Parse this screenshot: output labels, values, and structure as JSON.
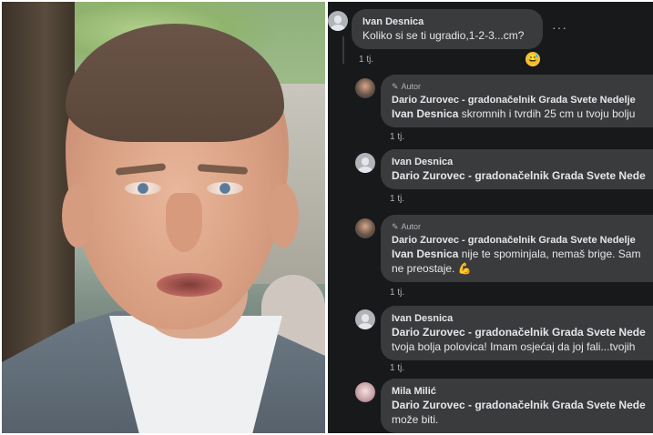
{
  "comments": [
    {
      "author": "Ivan Desnica",
      "text": "Koliko si se ti ugradio,1-2-3...cm?",
      "time": "1 tj.",
      "badge": "",
      "reaction": "😅"
    },
    {
      "author": "Dario Zurovec - gradonačelnik Grada Svete Nedelje",
      "badge": "Autor",
      "mention": "Ivan Desnica",
      "text": " skromnih i tvrdih 25 cm u tvoju bolju",
      "time": "1 tj."
    },
    {
      "author": "Ivan Desnica",
      "mention": "Dario Zurovec - gradonačelnik Grada Svete Nede",
      "text": "",
      "time": "1 tj."
    },
    {
      "author": "Dario Zurovec - gradonačelnik Grada Svete Nedelje",
      "badge": "Autor",
      "mention": "Ivan Desnica",
      "text": " nije te spominjala, nemaš brige. Sam",
      "text2": "ne preostaje. 💪",
      "time": "1 tj."
    },
    {
      "author": "Ivan Desnica",
      "mention": "Dario Zurovec - gradonačelnik Grada Svete Nede",
      "text2": "tvoja bolja polovica! Imam osjećaj da joj fali...tvojih",
      "time": "1 tj."
    },
    {
      "author": "Mila Milić",
      "mention": "Dario Zurovec - gradonačelnik Grada Svete Nede",
      "text2": "može biti."
    }
  ],
  "more_label": "···",
  "colors": {
    "panel_bg": "#18191a",
    "bubble_bg": "#3a3b3c",
    "text_primary": "#e4e6eb",
    "text_secondary": "#b0b3b8"
  }
}
